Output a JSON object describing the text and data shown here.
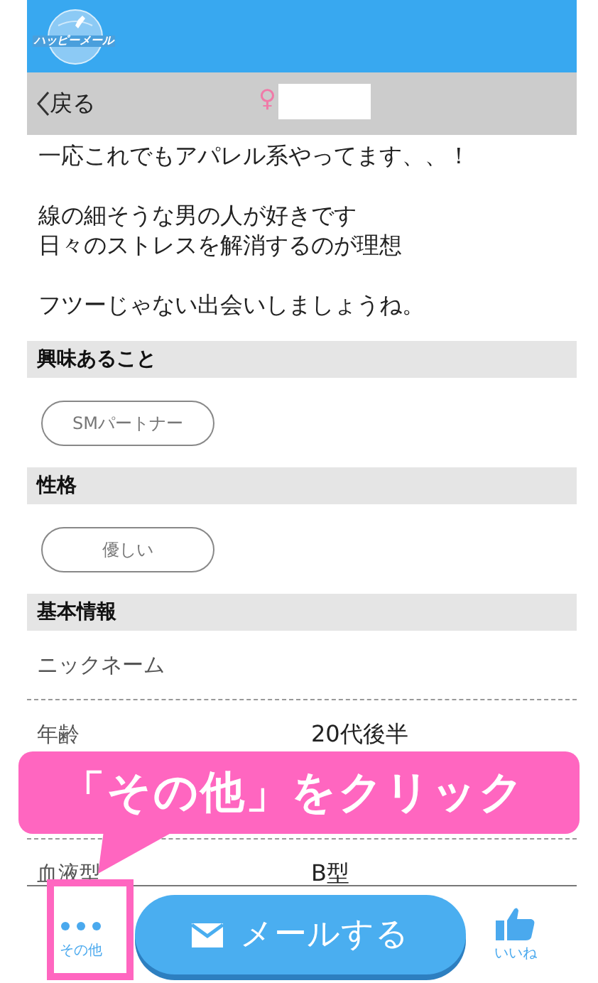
{
  "header": {
    "logo_text": "ハッピーメール"
  },
  "nav": {
    "back": "戻る",
    "gender_symbol": "♀"
  },
  "profile_paragraphs": [
    [
      "一応これでもアパレル系やってます、、！"
    ],
    [
      "線の細そうな男の人が好きです",
      "日々のストレスを解消するのが理想"
    ],
    [
      "フツーじゃない出会いしましょうね。"
    ]
  ],
  "sections": [
    {
      "title": "興味あること",
      "tags": [
        "SMパートナー"
      ]
    },
    {
      "title": "性格",
      "tags": [
        "優しい"
      ]
    }
  ],
  "basic_info": {
    "title": "基本情報",
    "rows": [
      {
        "label": "ニックネーム"
      },
      {
        "label": "年齢",
        "value": "20代後半"
      },
      {
        "label": "血液型",
        "value": "B型"
      }
    ]
  },
  "bottom_bar": {
    "more": "その他",
    "mail": "メールする",
    "like": "いいね"
  },
  "callout": {
    "text": "「その他」をクリック"
  }
}
